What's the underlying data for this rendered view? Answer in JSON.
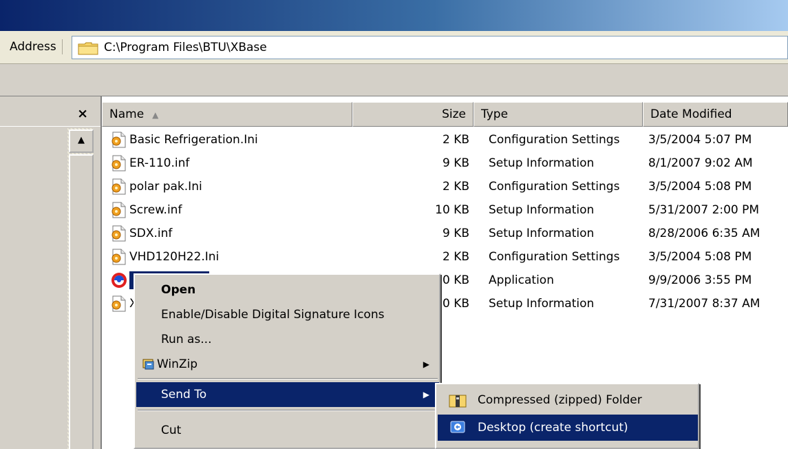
{
  "address": {
    "label": "Address",
    "path": "C:\\Program Files\\BTU\\XBase"
  },
  "left_pane": {
    "close_glyph": "×",
    "scroll_up_glyph": "▲"
  },
  "columns": {
    "name": "Name",
    "sort_glyph": "▲",
    "size": "Size",
    "type": "Type",
    "date": "Date Modified"
  },
  "files": [
    {
      "name": "Basic Refrigeration.Ini",
      "size": "2 KB",
      "type": "Configuration Settings",
      "date": "3/5/2004 5:07 PM",
      "icon": "config-file-icon"
    },
    {
      "name": "ER-110.inf",
      "size": "9 KB",
      "type": "Setup Information",
      "date": "8/1/2007 9:02 AM",
      "icon": "setup-file-icon"
    },
    {
      "name": "polar pak.Ini",
      "size": "2 KB",
      "type": "Configuration Settings",
      "date": "3/5/2004 5:08 PM",
      "icon": "config-file-icon"
    },
    {
      "name": "Screw.inf",
      "size": "10 KB",
      "type": "Setup Information",
      "date": "5/31/2007 2:00 PM",
      "icon": "setup-file-icon"
    },
    {
      "name": "SDX.inf",
      "size": "9 KB",
      "type": "Setup Information",
      "date": "8/28/2006 6:35 AM",
      "icon": "setup-file-icon"
    },
    {
      "name": "VHD120H22.Ini",
      "size": "2 KB",
      "type": "Configuration Settings",
      "date": "3/5/2004 5:08 PM",
      "icon": "config-file-icon"
    },
    {
      "name": "",
      "size": "0 KB",
      "type": "Application",
      "date": "9/9/2006 3:55 PM",
      "icon": "application-icon",
      "selected": true
    },
    {
      "name": "X",
      "size": "0 KB",
      "type": "Setup Information",
      "date": "7/31/2007 8:37 AM",
      "icon": "setup-file-icon"
    }
  ],
  "context_menu": {
    "open": "Open",
    "digital_signature": "Enable/Disable Digital Signature Icons",
    "run_as": "Run as...",
    "winzip": "WinZip",
    "send_to": "Send To",
    "cut": "Cut",
    "submenu_arrow": "▶"
  },
  "send_to_menu": {
    "compressed": "Compressed (zipped) Folder",
    "desktop": "Desktop (create shortcut)"
  },
  "colors": {
    "highlight": "#0a246a",
    "face": "#d4d0c8"
  }
}
